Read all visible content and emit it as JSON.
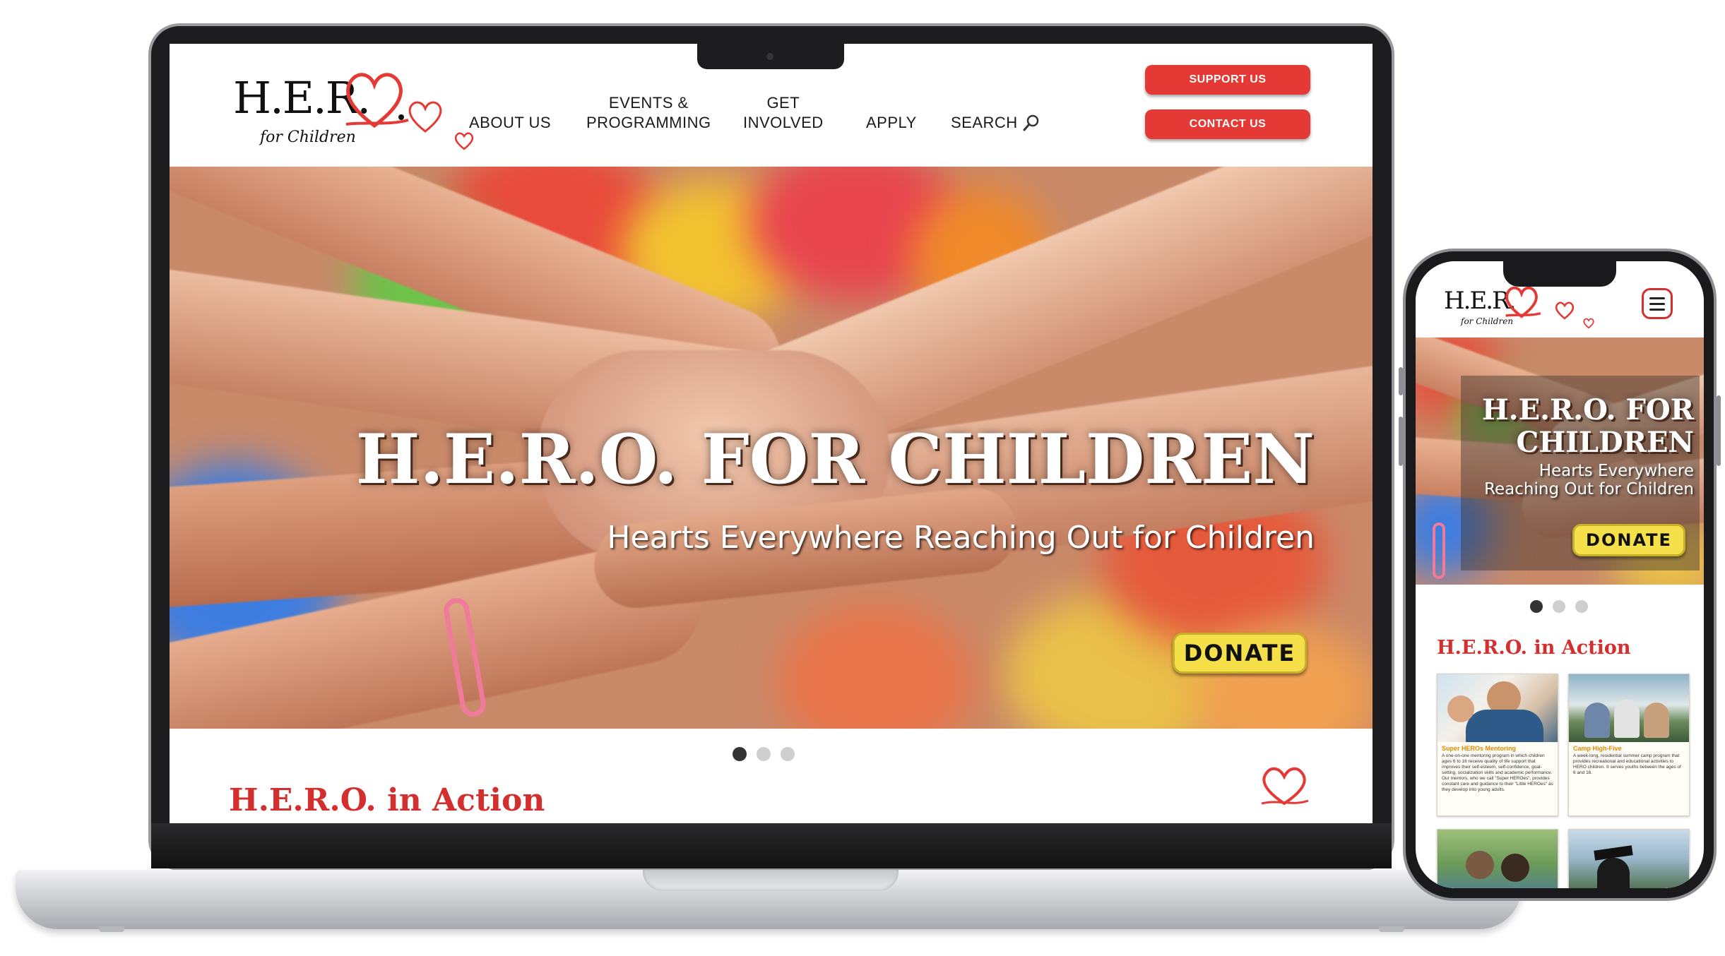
{
  "brand": {
    "logo_main": "H.E.R.",
    "logo_sub": "for Children",
    "red": "#e53935",
    "dark_red": "#d32f2f",
    "yellow": "#f5e04a"
  },
  "nav": {
    "about": "ABOUT US",
    "events_line1": "EVENTS &",
    "events_line2": "PROGRAMMING",
    "get_line1": "GET",
    "get_line2": "INVOLVED",
    "apply": "APPLY",
    "search": "SEARCH"
  },
  "header_buttons": {
    "support": "SUPPORT US",
    "contact": "CONTACT US"
  },
  "hero": {
    "title": "H.E.R.O. FOR CHILDREN",
    "title_line1": "H.E.R.O. FOR",
    "title_line2": "CHILDREN",
    "subtitle": "Hearts Everywhere Reaching Out for Children",
    "subtitle_line1": "Hearts Everywhere",
    "subtitle_line2": "Reaching Out for Children",
    "donate": "DONATE"
  },
  "carousel": {
    "slides": 3,
    "active": 1
  },
  "section": {
    "title": "H.E.R.O. in Action"
  },
  "cards": [
    {
      "title": "Super HEROs Mentoring",
      "text": "A one-on-one mentoring program in which children ages 6 to 16 receive quality of life support that improves their self-esteem, self-confidence, goal-setting, socialization skills and academic performance. Our mentors, who we call \"Super HEROes\", provides constant care and guidance to their \"Little HEROes\" as they develop into young adults."
    },
    {
      "title": "Camp High-Five",
      "text": "A week-long, residential summer camp program that provides recreational and educational activities to HERO children. It serves youths between the ages of 6 and 16."
    }
  ],
  "icons": {
    "search": "search-icon",
    "menu": "hamburger-menu-icon",
    "heart": "heart-icon"
  }
}
